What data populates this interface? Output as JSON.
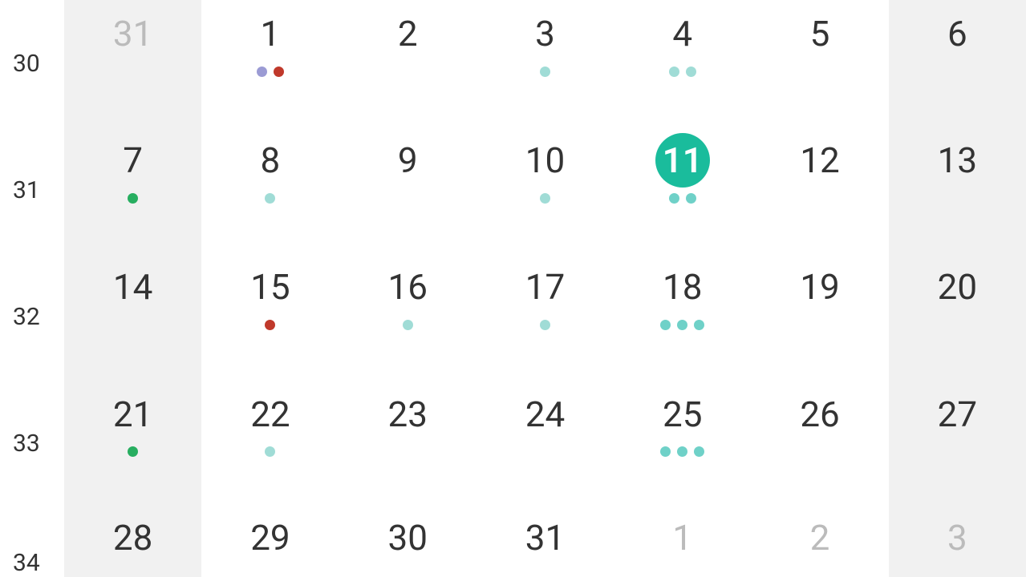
{
  "weeks": [
    {
      "num": "30",
      "days": [
        {
          "d": "31",
          "other": true,
          "weekend": true,
          "dots": []
        },
        {
          "d": "1",
          "other": false,
          "weekend": false,
          "dots": [
            "purple",
            "red"
          ]
        },
        {
          "d": "2",
          "other": false,
          "weekend": false,
          "dots": []
        },
        {
          "d": "3",
          "other": false,
          "weekend": false,
          "dots": [
            "teal-light"
          ]
        },
        {
          "d": "4",
          "other": false,
          "weekend": false,
          "dots": [
            "teal-light",
            "teal-light"
          ]
        },
        {
          "d": "5",
          "other": false,
          "weekend": false,
          "dots": []
        },
        {
          "d": "6",
          "other": false,
          "weekend": true,
          "dots": []
        }
      ]
    },
    {
      "num": "31",
      "days": [
        {
          "d": "7",
          "other": false,
          "weekend": true,
          "dots": [
            "green"
          ]
        },
        {
          "d": "8",
          "other": false,
          "weekend": false,
          "dots": [
            "teal-light"
          ]
        },
        {
          "d": "9",
          "other": false,
          "weekend": false,
          "dots": []
        },
        {
          "d": "10",
          "other": false,
          "weekend": false,
          "dots": [
            "teal-light"
          ]
        },
        {
          "d": "11",
          "other": false,
          "weekend": false,
          "dots": [
            "teal",
            "teal"
          ],
          "today": true
        },
        {
          "d": "12",
          "other": false,
          "weekend": false,
          "dots": []
        },
        {
          "d": "13",
          "other": false,
          "weekend": true,
          "dots": []
        }
      ]
    },
    {
      "num": "32",
      "days": [
        {
          "d": "14",
          "other": false,
          "weekend": true,
          "dots": []
        },
        {
          "d": "15",
          "other": false,
          "weekend": false,
          "dots": [
            "red"
          ]
        },
        {
          "d": "16",
          "other": false,
          "weekend": false,
          "dots": [
            "teal-light"
          ]
        },
        {
          "d": "17",
          "other": false,
          "weekend": false,
          "dots": [
            "teal-light"
          ]
        },
        {
          "d": "18",
          "other": false,
          "weekend": false,
          "dots": [
            "teal",
            "teal",
            "teal"
          ]
        },
        {
          "d": "19",
          "other": false,
          "weekend": false,
          "dots": []
        },
        {
          "d": "20",
          "other": false,
          "weekend": true,
          "dots": []
        }
      ]
    },
    {
      "num": "33",
      "days": [
        {
          "d": "21",
          "other": false,
          "weekend": true,
          "dots": [
            "green"
          ]
        },
        {
          "d": "22",
          "other": false,
          "weekend": false,
          "dots": [
            "teal-light"
          ]
        },
        {
          "d": "23",
          "other": false,
          "weekend": false,
          "dots": []
        },
        {
          "d": "24",
          "other": false,
          "weekend": false,
          "dots": []
        },
        {
          "d": "25",
          "other": false,
          "weekend": false,
          "dots": [
            "teal",
            "teal",
            "teal"
          ]
        },
        {
          "d": "26",
          "other": false,
          "weekend": false,
          "dots": []
        },
        {
          "d": "27",
          "other": false,
          "weekend": true,
          "dots": []
        }
      ]
    },
    {
      "num": "34",
      "days": [
        {
          "d": "28",
          "other": false,
          "weekend": true,
          "dots": []
        },
        {
          "d": "29",
          "other": false,
          "weekend": false,
          "dots": []
        },
        {
          "d": "30",
          "other": false,
          "weekend": false,
          "dots": []
        },
        {
          "d": "31",
          "other": false,
          "weekend": false,
          "dots": []
        },
        {
          "d": "1",
          "other": true,
          "weekend": false,
          "dots": []
        },
        {
          "d": "2",
          "other": true,
          "weekend": false,
          "dots": []
        },
        {
          "d": "3",
          "other": true,
          "weekend": true,
          "dots": []
        }
      ]
    }
  ]
}
